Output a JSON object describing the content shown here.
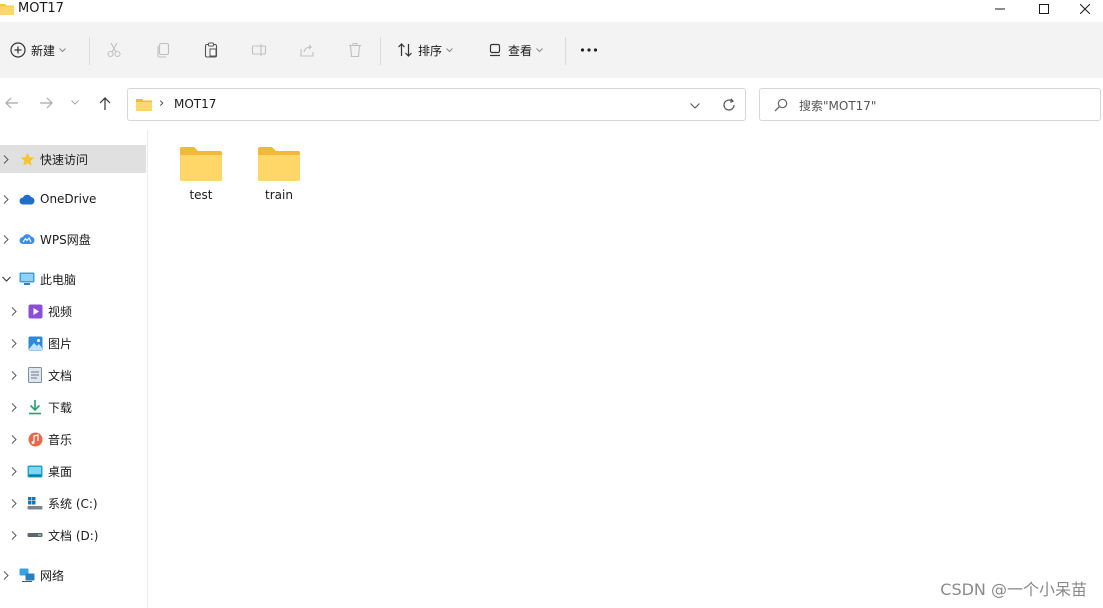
{
  "window": {
    "title": "MOT17",
    "minimize_icon": "minimize-icon",
    "maximize_icon": "maximize-icon",
    "close_icon": "close-icon"
  },
  "toolbar": {
    "new_label": "新建",
    "sort_label": "排序",
    "view_label": "查看",
    "more_label": "···",
    "icons": [
      "plus-circle-icon",
      "cut-icon",
      "copy-icon",
      "paste-icon",
      "rename-icon",
      "share-icon",
      "delete-icon",
      "sort-icon",
      "view-icon",
      "more-icon"
    ]
  },
  "address": {
    "path_separator": "›",
    "path": "MOT17",
    "search_placeholder": "搜索\"MOT17\""
  },
  "sidebar": {
    "items": [
      {
        "label": "快速访问",
        "icon": "star-icon"
      },
      {
        "label": "OneDrive",
        "icon": "cloud-icon"
      },
      {
        "label": "WPS网盘",
        "icon": "wps-cloud-icon"
      },
      {
        "label": "此电脑",
        "icon": "computer-icon"
      },
      {
        "label": "视频",
        "icon": "video-icon"
      },
      {
        "label": "图片",
        "icon": "pictures-icon"
      },
      {
        "label": "文档",
        "icon": "documents-icon"
      },
      {
        "label": "下载",
        "icon": "download-icon"
      },
      {
        "label": "音乐",
        "icon": "music-icon"
      },
      {
        "label": "桌面",
        "icon": "desktop-icon"
      },
      {
        "label": "系统 (C:)",
        "icon": "drive-c-icon"
      },
      {
        "label": "文档 (D:)",
        "icon": "drive-d-icon"
      },
      {
        "label": "网络",
        "icon": "network-icon"
      }
    ]
  },
  "content": {
    "folders": [
      {
        "name": "test"
      },
      {
        "name": "train"
      }
    ]
  },
  "watermark": "CSDN @一个小呆苗",
  "colors": {
    "folder_yellow": "#f8c84c",
    "folder_light": "#ffe08a",
    "toolbar_bg": "#f3f3f3",
    "selected_bg": "#e0e0e0",
    "accent_blue": "#1f6fc7"
  }
}
